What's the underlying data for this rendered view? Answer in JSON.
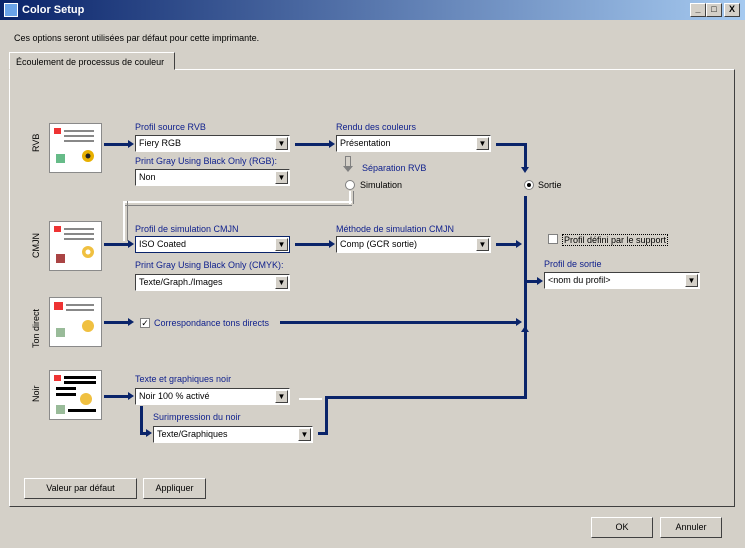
{
  "window": {
    "title": "Color Setup",
    "buttons": [
      "_",
      "□",
      "X"
    ]
  },
  "subtitle": "Ces options seront utilisées par défaut pour cette imprimante.",
  "tab": "Écoulement de processus de couleur",
  "rows": {
    "rvb": "RVB",
    "cmjn": "CMJN",
    "ton_direct": "Ton direct",
    "noir": "Noir"
  },
  "rvb": {
    "source_label": "Profil source RVB",
    "source_value": "Fiery RGB",
    "gray_label": "Print Gray Using Black Only (RGB):",
    "gray_value": "Non",
    "rendu_label": "Rendu des couleurs",
    "rendu_value": "Présentation",
    "separation_label": "Séparation RVB",
    "simulation_label": "Simulation",
    "sortie_label": "Sortie"
  },
  "cmjn": {
    "sim_label": "Profil de simulation CMJN",
    "sim_value": "ISO Coated",
    "gray_label": "Print Gray Using Black Only (CMYK):",
    "gray_value": "Texte/Graph./Images",
    "method_label": "Méthode de simulation CMJN",
    "method_value": "Comp (GCR sortie)"
  },
  "output": {
    "profil_support_label": "Profil défini par le support",
    "profil_sortie_label": "Profil de sortie",
    "profil_sortie_value": "<nom du profil>"
  },
  "ton_direct": {
    "checkbox_label": "Correspondance tons directs"
  },
  "noir": {
    "texte_label": "Texte et graphiques noir",
    "texte_value": "Noir 100 % activé",
    "surimp_label": "Surimpression du noir",
    "surimp_value": "Texte/Graphiques"
  },
  "buttons": {
    "default": "Valeur par défaut",
    "apply": "Appliquer",
    "ok": "OK",
    "cancel": "Annuler"
  },
  "colors": {
    "accent": "#0a246a",
    "label": "#0d1e8c",
    "face": "#d4d0c8"
  }
}
